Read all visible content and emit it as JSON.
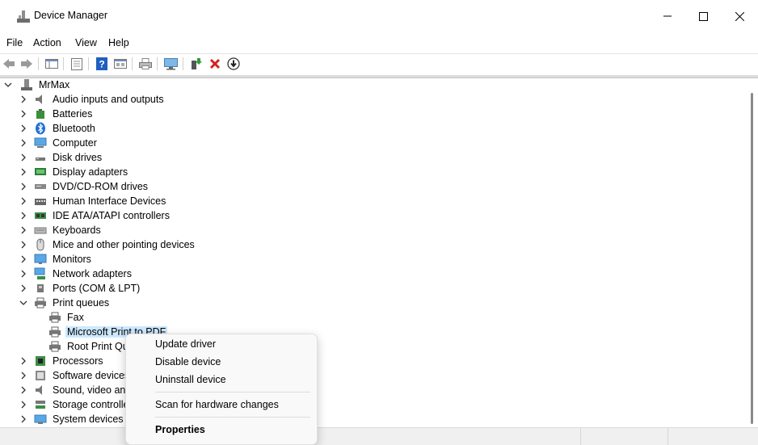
{
  "window": {
    "title": "Device Manager"
  },
  "menu": [
    "File",
    "Action",
    "View",
    "Help"
  ],
  "tree": {
    "root": "MrMax",
    "categories": [
      "Audio inputs and outputs",
      "Batteries",
      "Bluetooth",
      "Computer",
      "Disk drives",
      "Display adapters",
      "DVD/CD-ROM drives",
      "Human Interface Devices",
      "IDE ATA/ATAPI controllers",
      "Keyboards",
      "Mice and other pointing devices",
      "Monitors",
      "Network adapters",
      "Ports (COM & LPT)",
      "Print queues"
    ],
    "print_queue_children": [
      "Fax",
      "Microsoft Print to PDF",
      "Root Print Qu"
    ],
    "after_categories": [
      "Processors",
      "Software devices",
      "Sound, video and",
      "Storage controller",
      "System devices"
    ]
  },
  "context_menu": {
    "items": [
      "Update driver",
      "Disable device",
      "Uninstall device"
    ],
    "scan": "Scan for hardware changes",
    "properties": "Properties"
  },
  "colors": {
    "selection": "#cce8ff",
    "uninstall_red": "#d32020",
    "help_blue": "#1f5fbf"
  }
}
